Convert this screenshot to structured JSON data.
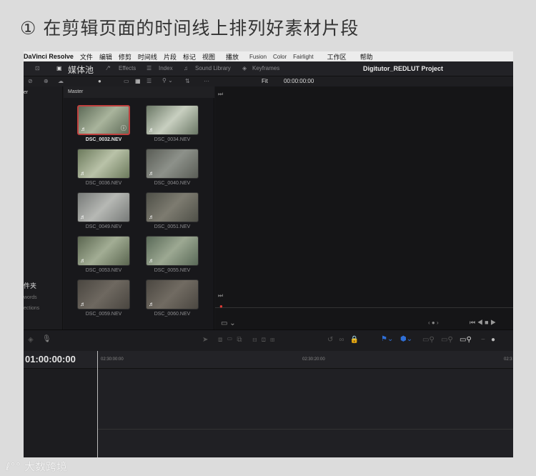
{
  "title": "① 在剪辑页面的时间线上排列好素材片段",
  "menu": {
    "app": "DaVinci Resolve",
    "items": [
      "文件",
      "编辑",
      "修剪",
      "时间线",
      "片段",
      "标记",
      "视图",
      "播放"
    ],
    "pages": [
      "Fusion",
      "Color",
      "Fairlight"
    ],
    "items2": [
      "工作区",
      "帮助"
    ]
  },
  "toolbar": {
    "media_pool": "媒体池",
    "effects": "Effects",
    "index": "Index",
    "sound_library": "Sound Library",
    "keyframes": "Keyframes",
    "project": "Digitutor_REDLUT  Project"
  },
  "toolbar2": {
    "fit": "Fit",
    "timecode": "00:00:00:00"
  },
  "sidebar": {
    "master": "er",
    "folder": "件夹",
    "keywords": "words",
    "collections": "ections"
  },
  "pool": {
    "header": "Master",
    "clips": [
      "DSC_0032.NEV",
      "DSC_0034.NEV",
      "DSC_0036.NEV",
      "DSC_0040.NEV",
      "DSC_0049.NEV",
      "DSC_0051.NEV",
      "DSC_0053.NEV",
      "DSC_0055.NEV",
      "DSC_0059.NEV",
      "DSC_0060.NEV"
    ]
  },
  "timeline": {
    "timecode": "01:00:00:00",
    "ticks": [
      "02:30:00:00",
      "02:30:20:00",
      "02:3"
    ]
  },
  "watermark": "大数跨境"
}
